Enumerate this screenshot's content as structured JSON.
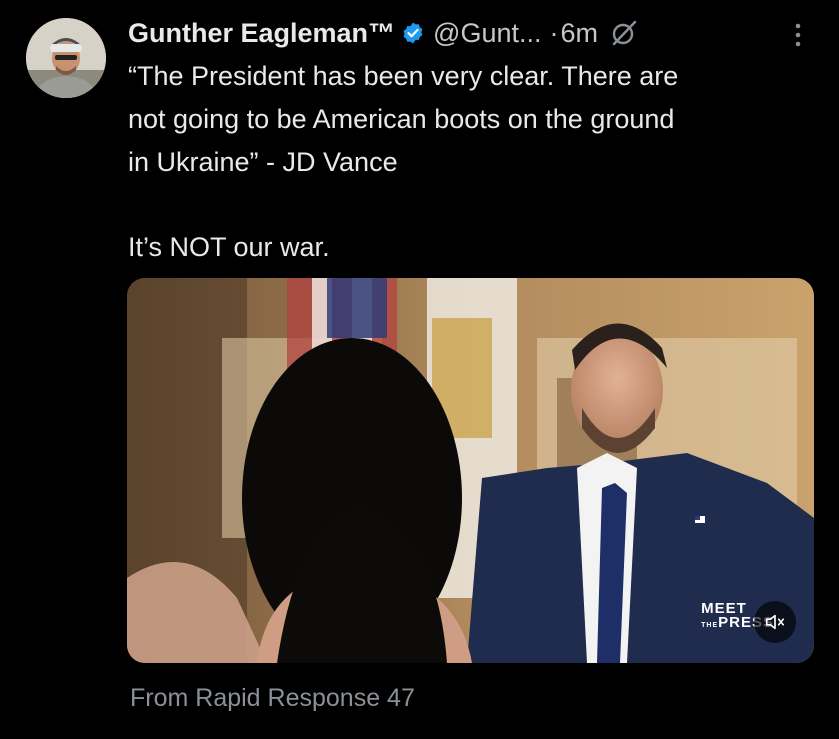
{
  "author": {
    "display_name": "Gunther Eagleman™",
    "handle": "@Gunt...",
    "separator": "·",
    "time_ago": "6m",
    "verified": true
  },
  "tweet": {
    "lines": [
      "“The President has been very clear. There are",
      "not going to be American boots on the ground",
      "in Ukraine” - JD Vance"
    ],
    "second_paragraph": "It’s NOT our war."
  },
  "media": {
    "watermark_line1": "MEET",
    "watermark_small": "THE",
    "watermark_line2": "PRESS",
    "muted": true
  },
  "source": "From Rapid Response 47",
  "colors": {
    "background": "#000000",
    "text": "#e7e9ea",
    "secondary": "#8b9096",
    "verified_badge": "#1d9bf0"
  },
  "icons": [
    "verified-badge-icon",
    "grok-icon",
    "more-options-icon",
    "volume-muted-icon"
  ]
}
